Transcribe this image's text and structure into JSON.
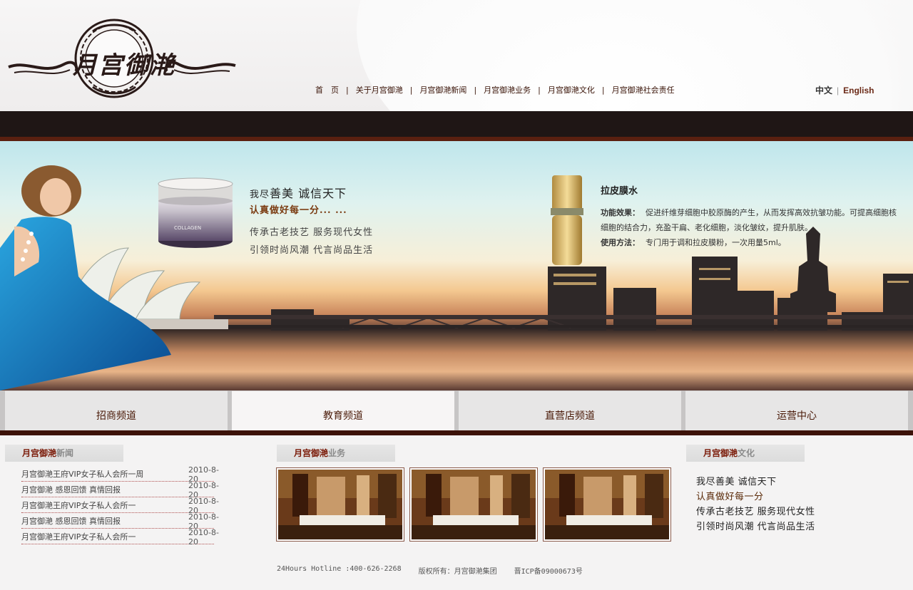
{
  "brand": {
    "logo_text": "月宫御滟"
  },
  "nav": {
    "items": [
      "首　页",
      "关于月宫御滟",
      "月宫御滟新闻",
      "月宫御滟业务",
      "月宫御滟文化",
      "月宫御滟社会责任"
    ],
    "separator": "|"
  },
  "lang": {
    "zh": "中文",
    "separator": "|",
    "en": "English"
  },
  "banner": {
    "slogan_small": "我尽",
    "slogan_big": "善美  诚信天下",
    "slogan_line2": "认真做好每一分...   ...",
    "slogan_line3": "传承古老技艺  服务现代女性",
    "slogan_line4": "引领时尚风潮  代言尚品生活",
    "jar_label": "COLLAGEN",
    "product": {
      "title": "拉皮膜水",
      "effect_label": "功能效果：",
      "effect_text": "促进纤维芽细胞中胶原酶的产生，从而发挥高效抗皱功能。可提高细胞核细胞的结合力，充盈干扁、老化细胞，淡化皱纹，提升肌肤。",
      "usage_label": "使用方法：",
      "usage_text": "专门用于调和拉皮膜粉，一次用量5ml。"
    }
  },
  "channels": [
    "招商频道",
    "教育频道",
    "直营店频道",
    "运营中心"
  ],
  "news": {
    "heading_a": "月宫御滟",
    "heading_b": "新闻",
    "items": [
      {
        "title": "月宫御滟王府VIP女子私人会所一周",
        "date": "2010-8-20"
      },
      {
        "title": "月宫御滟  感恩回馈  真情回报",
        "date": "2010-8-20"
      },
      {
        "title": "月宫御滟王府VIP女子私人会所一",
        "date": "2010-8-20"
      },
      {
        "title": "月宫御滟  感恩回馈  真情回报",
        "date": "2010-8-20"
      },
      {
        "title": "月宫御滟王府VIP女子私人会所一",
        "date": "2010-8-20"
      }
    ]
  },
  "business": {
    "heading_a": "月宫御滟",
    "heading_b": "业务"
  },
  "culture": {
    "heading_a": "月宫御滟",
    "heading_b": "文化",
    "lines": [
      "我尽善美  诚信天下",
      "认真做好每一分",
      "传承古老技艺  服务现代女性",
      "引领时尚风潮  代言尚品生活"
    ]
  },
  "footer": {
    "hotline": "24Hours Hotline :400-626-2268",
    "copyright": "版权所有：月宫御滟集团",
    "icp": "晋ICP备09000673号"
  },
  "colors": {
    "accent": "#5a2010",
    "dark_bar": "#1f1615",
    "link": "#3a1408"
  }
}
